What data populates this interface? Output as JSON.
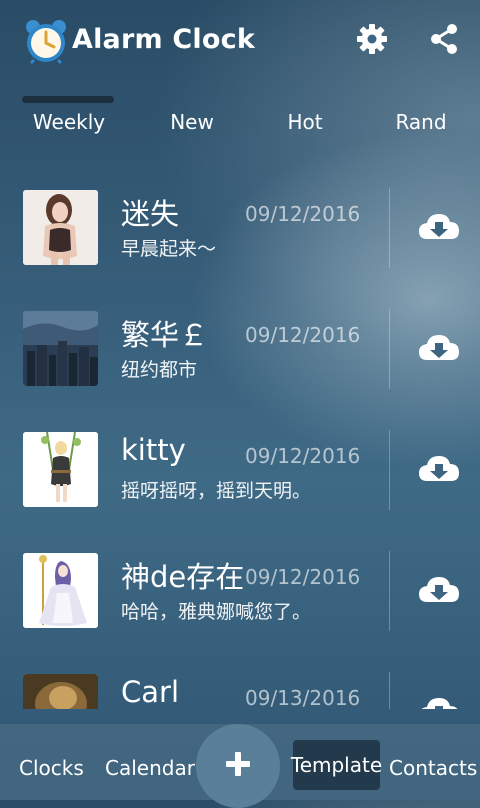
{
  "header": {
    "title": "Alarm Clock",
    "app_icon": "alarm-clock-icon",
    "settings_icon": "gear-icon",
    "share_icon": "share-icon"
  },
  "tabs": [
    {
      "label": "Weekly",
      "selected": true
    },
    {
      "label": "New",
      "selected": false
    },
    {
      "label": "Hot",
      "selected": false
    },
    {
      "label": "Rand",
      "selected": false
    }
  ],
  "items": [
    {
      "title": "迷失",
      "date": "09/12/2016",
      "subtitle": "早晨起来～",
      "thumb": "woman-portrait"
    },
    {
      "title": "繁华￡",
      "date": "09/12/2016",
      "subtitle": "纽约都市",
      "thumb": "city-skyline"
    },
    {
      "title": "kitty",
      "date": "09/12/2016",
      "subtitle": "摇呀摇呀，摇到天明。",
      "thumb": "girl-on-swing"
    },
    {
      "title": "神de存在",
      "date": "09/12/2016",
      "subtitle": "哈哈，雅典娜喊您了。",
      "thumb": "anime-goddess"
    },
    {
      "title": "Carl",
      "date": "09/13/2016",
      "subtitle": "",
      "thumb": "fantasy-scene"
    }
  ],
  "download_icon": "cloud-download-icon",
  "bottom_nav": {
    "clocks": "Clocks",
    "calendar": "Calendar",
    "add_icon": "plus-icon",
    "template": "Template",
    "contacts": "Contacts"
  },
  "colors": {
    "background": "#365d79",
    "tab_indicator": "#1d2f3f",
    "bottom_bar": "#46698299",
    "template_active": "#233a4d"
  }
}
